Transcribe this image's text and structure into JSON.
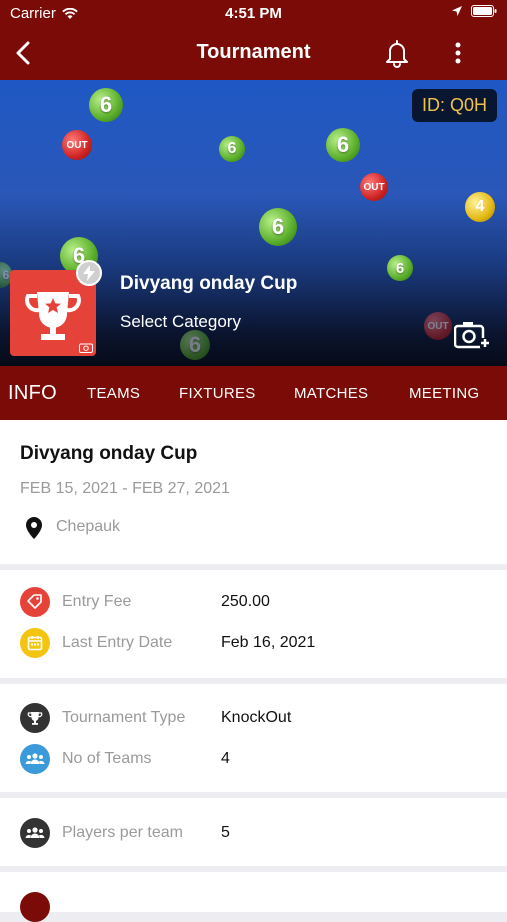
{
  "status_bar": {
    "carrier": "Carrier",
    "time": "4:51 PM"
  },
  "nav": {
    "title": "Tournament"
  },
  "banner": {
    "id_badge": "ID: Q0H",
    "tournament_name": "Divyang onday Cup",
    "category": "Select Category"
  },
  "tabs": [
    {
      "label": "INFO",
      "active": true
    },
    {
      "label": "TEAMS"
    },
    {
      "label": "FIXTURES"
    },
    {
      "label": "MATCHES"
    },
    {
      "label": "MEETING"
    }
  ],
  "info": {
    "name": "Divyang onday Cup",
    "dates": "FEB 15, 2021 - FEB 27, 2021",
    "location": "Chepauk"
  },
  "details": {
    "entry_fee_label": "Entry Fee",
    "entry_fee_value": "250.00",
    "last_entry_label": "Last Entry Date",
    "last_entry_value": "Feb 16, 2021",
    "type_label": "Tournament Type",
    "type_value": "KnockOut",
    "teams_label": "No of Teams",
    "teams_value": "4",
    "players_label": "Players per team",
    "players_value": "5"
  },
  "colors": {
    "primary": "#7b0b06",
    "accent_red": "#e5433a",
    "accent_yellow": "#f3c511",
    "accent_blue": "#3b9ad9",
    "accent_dark": "#333333",
    "id_text": "#f0c24a"
  }
}
